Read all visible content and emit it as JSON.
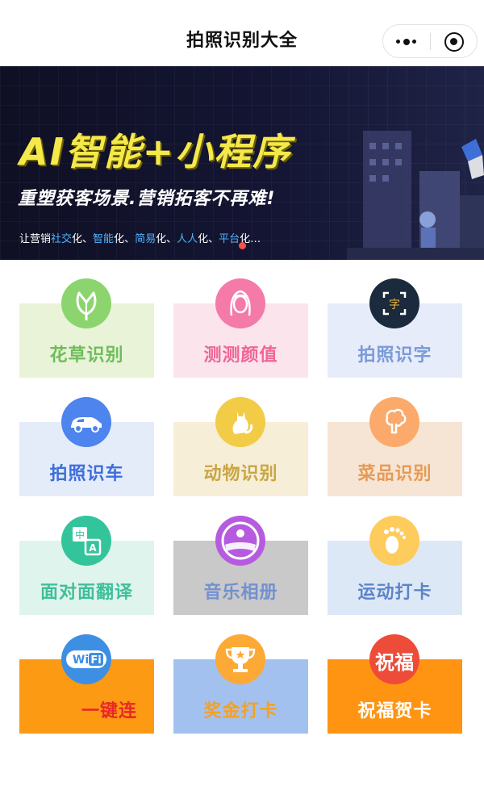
{
  "header": {
    "title": "拍照识别大全"
  },
  "banner": {
    "headline": "AI智能+小程序",
    "subheadline": "重塑获客场景.营销拓客不再难!",
    "tagline": [
      {
        "text": "让营销",
        "hl": false
      },
      {
        "text": "社交",
        "hl": true
      },
      {
        "text": "化、",
        "hl": false
      },
      {
        "text": "智能",
        "hl": true
      },
      {
        "text": "化、",
        "hl": false
      },
      {
        "text": "简易",
        "hl": true
      },
      {
        "text": "化、",
        "hl": false
      },
      {
        "text": "人人",
        "hl": true
      },
      {
        "text": "化、",
        "hl": false
      },
      {
        "text": "平台",
        "hl": true
      },
      {
        "text": "化…",
        "hl": false
      }
    ]
  },
  "tiles": [
    {
      "label": "花草识别",
      "icon": "flower-icon",
      "label_color": "#6ebd5a",
      "circle_color": "#8cd56e",
      "card_bg": "#e8f3d8"
    },
    {
      "label": "测测颜值",
      "icon": "face-icon",
      "label_color": "#f06597",
      "circle_color": "#f47aa8",
      "card_bg": "#fbe4ec"
    },
    {
      "label": "拍照识字",
      "icon": "scan-text-icon",
      "label_color": "#7a9ad8",
      "circle_color": "#1b2a3d",
      "card_bg": "#e6ecfa"
    },
    {
      "label": "拍照识车",
      "icon": "car-icon",
      "label_color": "#3d6edc",
      "circle_color": "#4d84ee",
      "card_bg": "#e4ecfa"
    },
    {
      "label": "动物识别",
      "icon": "cat-icon",
      "label_color": "#c9a544",
      "circle_color": "#f2cb47",
      "card_bg": "#f6eed6"
    },
    {
      "label": "菜品识别",
      "icon": "broccoli-icon",
      "label_color": "#e69a55",
      "circle_color": "#fbaa6b",
      "card_bg": "#f6e5d4"
    },
    {
      "label": "面对面翻译",
      "icon": "translate-icon",
      "label_color": "#3fbf9a",
      "circle_color": "#34c49c",
      "card_bg": "#dff4ec"
    },
    {
      "label": "音乐相册",
      "icon": "music-album-icon",
      "label_color": "#7390d0",
      "circle_color": "#b65be0",
      "card_bg": "#c9c9c9"
    },
    {
      "label": "运动打卡",
      "icon": "footprint-icon",
      "label_color": "#5b84c9",
      "circle_color": "#fdcc5c",
      "card_bg": "#dde8f7"
    },
    {
      "label": "一键连",
      "icon": "wifi-icon",
      "label_color": "#ea2727",
      "circle_color": "#3d8fe3",
      "card_bg": "#fd9a14"
    },
    {
      "label": "奖金打卡",
      "icon": "trophy-icon",
      "label_color": "#f6a020",
      "circle_color": "#fca935",
      "card_bg": "#a3c1ef"
    },
    {
      "label": "祝福贺卡",
      "icon": "greeting-icon",
      "icon_text": "祝福",
      "label_color": "#ffffff",
      "circle_color": "#ed4c38",
      "card_bg": "#fe9412"
    }
  ]
}
